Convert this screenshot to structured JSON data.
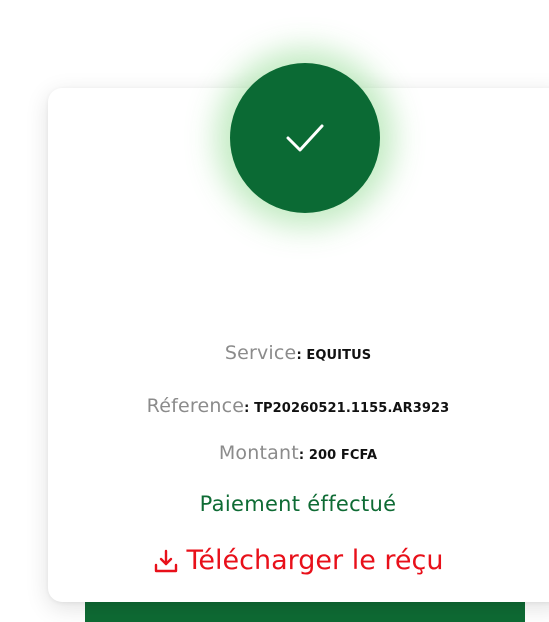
{
  "status_icon": "checkmark-icon",
  "receipt": {
    "service_label": "Service",
    "service_value": "EQUITUS",
    "reference_label": "Réference",
    "reference_value": "TP20260521.1155.AR3923",
    "amount_label": "Montant",
    "amount_value": "200 FCFA",
    "separator": ": "
  },
  "payment_status": "Paiement éffectué",
  "download": {
    "icon": "download-icon",
    "label": "Télécharger le réçu"
  },
  "colors": {
    "success_green": "#0b6a34",
    "glow": "#78d278",
    "label_gray": "#8b8b8b",
    "link_red": "#e8101a"
  }
}
